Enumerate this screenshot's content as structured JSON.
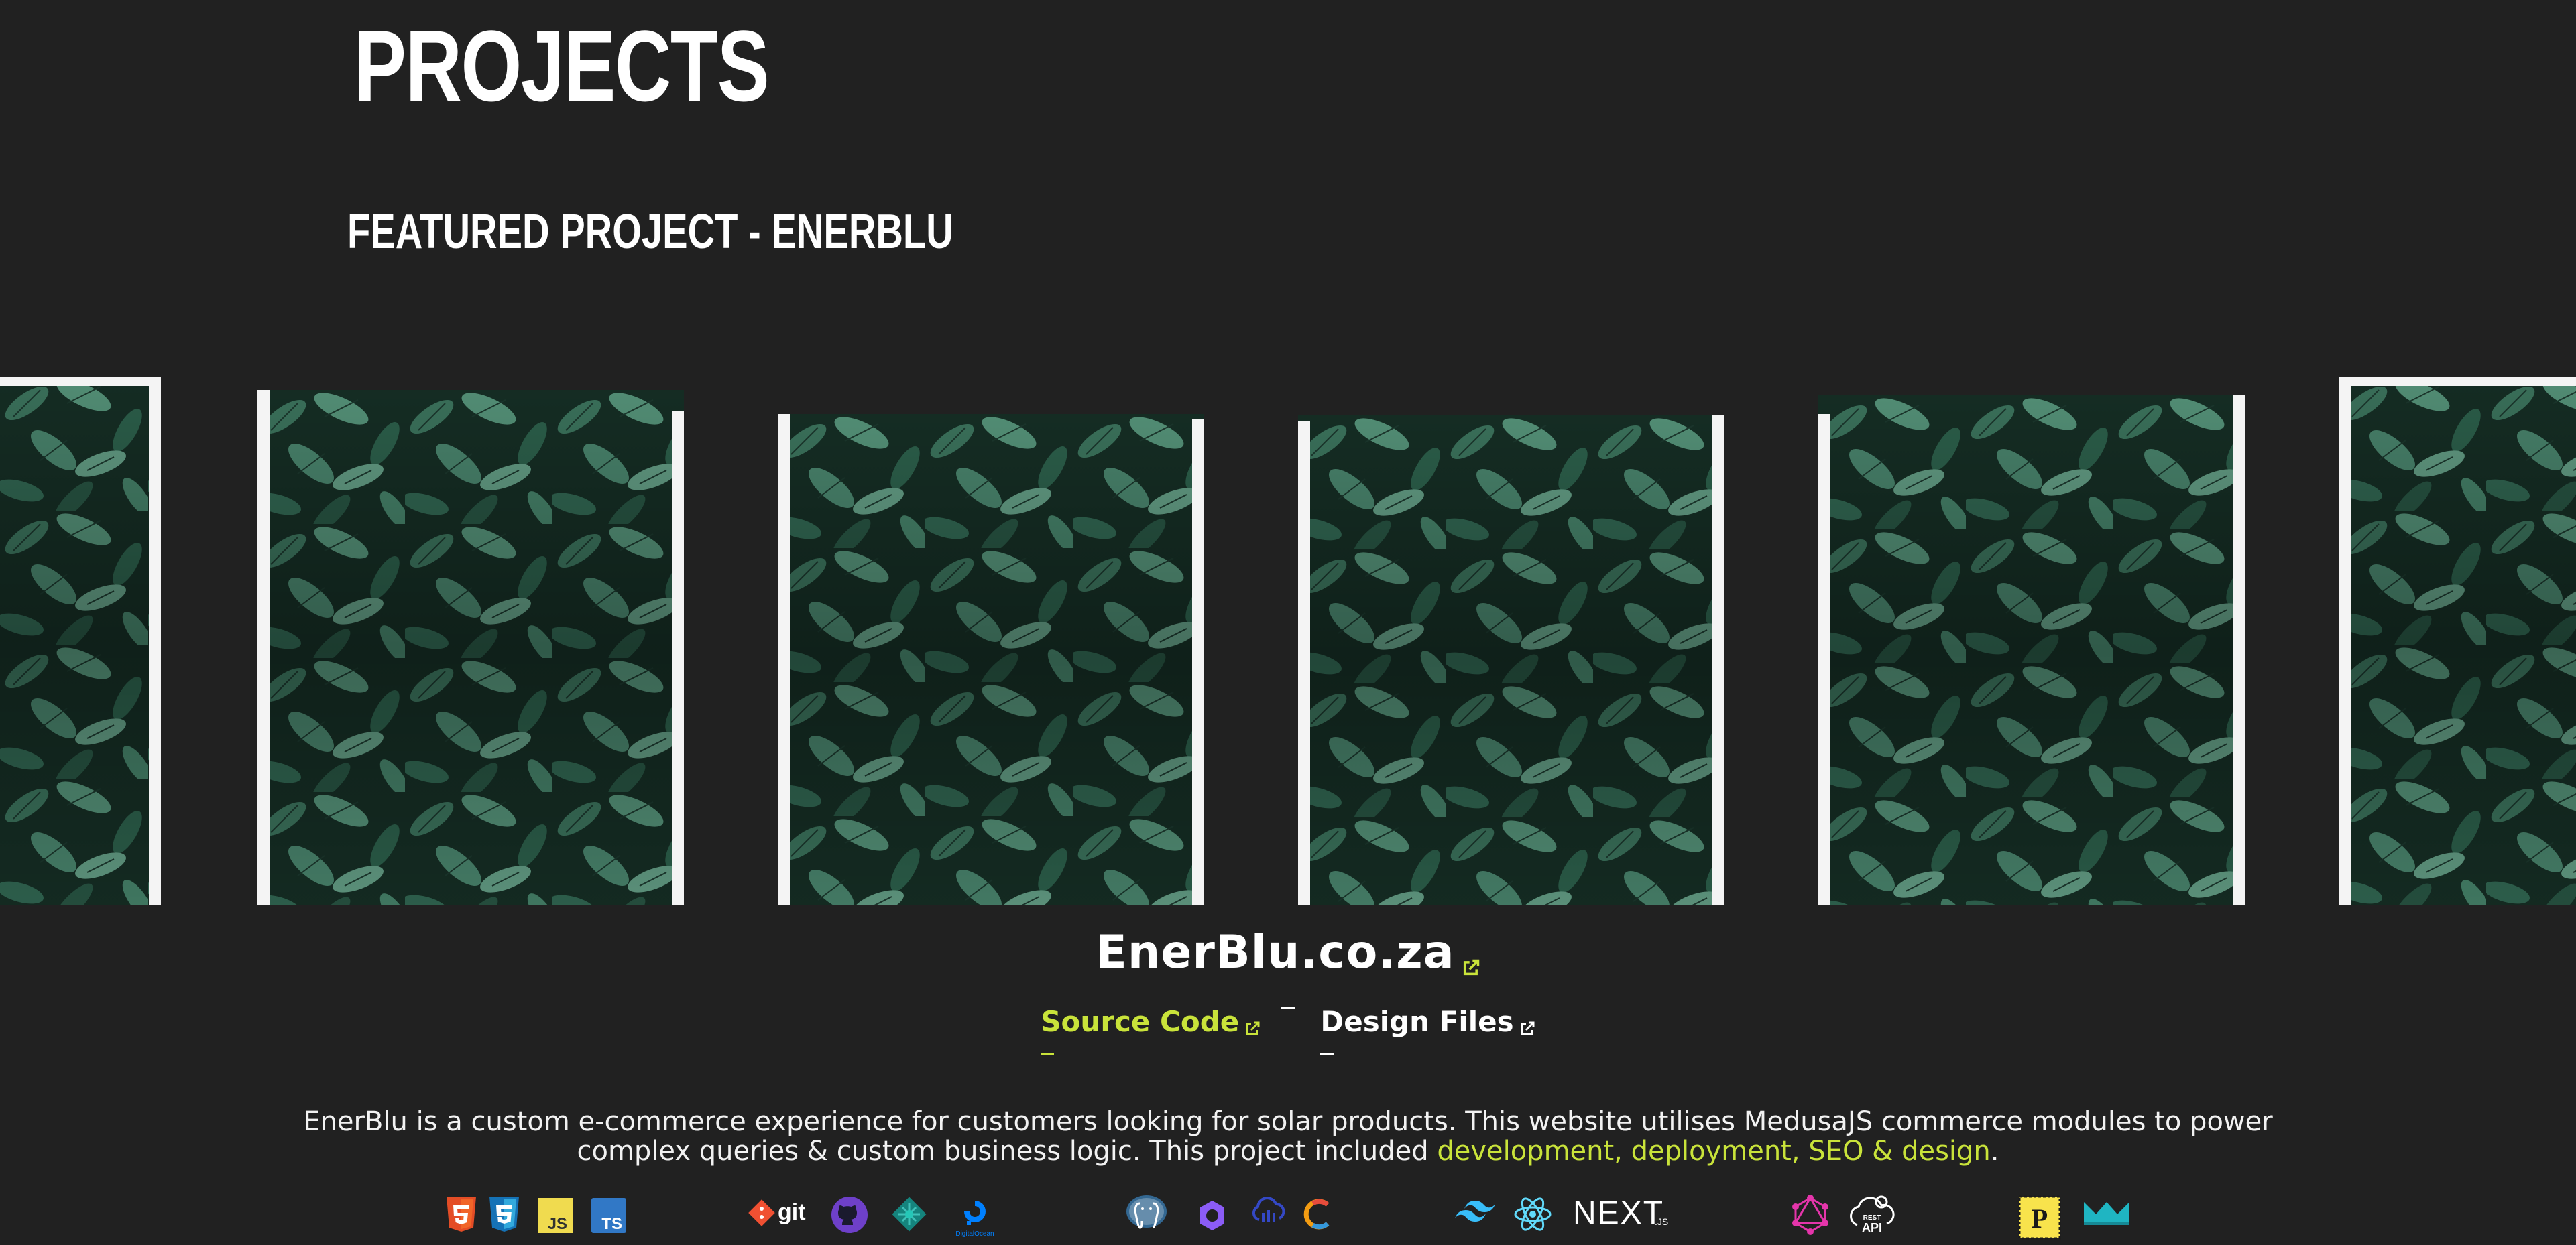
{
  "page": {
    "heading": "PROJECTS",
    "subheading": "FEATURED PROJECT - ENERBLU"
  },
  "carousel": {
    "image_description_icon": "leaf-photo",
    "panel_count": 6
  },
  "project": {
    "title": "EnerBlu.co.za",
    "source_code_label": "Source Code",
    "design_files_label": "Design Files",
    "description_part1": "EnerBlu is a custom e-commerce experience for customers looking for solar products. This website utilises MedusaJS commerce modules to power complex queries & custom business logic. This project included ",
    "description_highlight": "development, deployment, SEO & design",
    "description_part2": "."
  },
  "tech_icons": {
    "git_label": "git",
    "js_label": "JS",
    "ts_label": "TS",
    "digitalocean_label": "DigitalOcean",
    "next_label": "NEXT",
    "next_suffix": ".JS",
    "rest_label": "REST",
    "api_label": "API",
    "p_label": "P",
    "icons": [
      "html5-icon",
      "css3-icon",
      "javascript-icon",
      "typescript-icon",
      "git-icon",
      "github-icon",
      "netlify-icon",
      "digitalocean-icon",
      "postgresql-icon",
      "medusa-icon",
      "cloudinary-icon",
      "c-logo-icon",
      "tailwind-icon",
      "react-icon",
      "nextjs-icon",
      "graphql-icon",
      "rest-api-icon",
      "postman-stamp-icon",
      "styled-logo-icon"
    ]
  },
  "colors": {
    "background": "#212121",
    "accent": "#c9e33a",
    "text": "#ffffff"
  }
}
